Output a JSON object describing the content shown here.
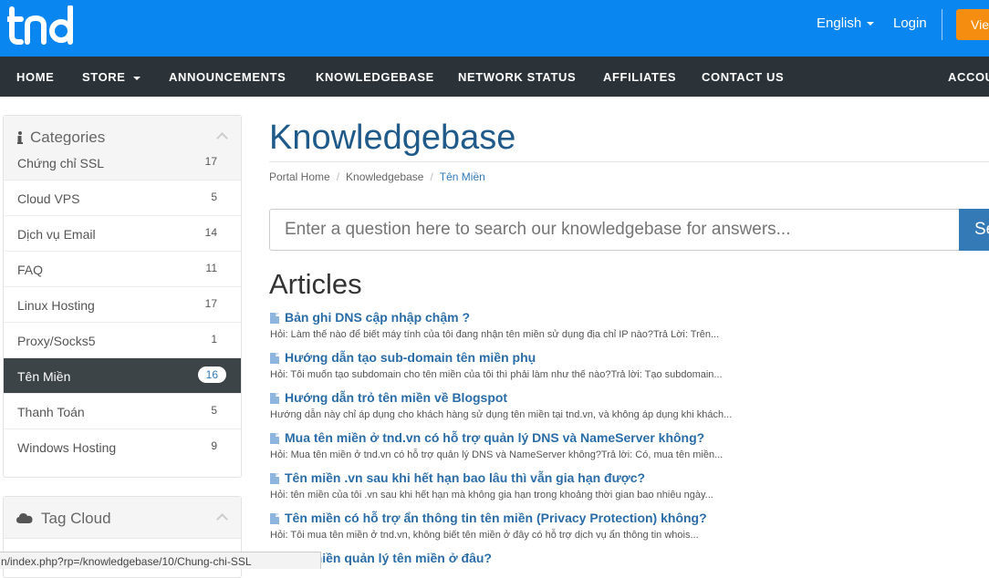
{
  "header": {
    "logo_text": "tnd",
    "language": "English",
    "login": "Login",
    "cta": "View"
  },
  "nav": {
    "items": [
      "HOME",
      "STORE",
      "ANNOUNCEMENTS",
      "KNOWLEDGEBASE",
      "NETWORK STATUS",
      "AFFILIATES",
      "CONTACT US",
      "ACCOUNT"
    ]
  },
  "sidebar": {
    "categories_title": "Categories",
    "categories": [
      {
        "name": "Chứng chỉ SSL",
        "count": "17"
      },
      {
        "name": "Cloud VPS",
        "count": "5"
      },
      {
        "name": "Dịch vụ Email",
        "count": "14"
      },
      {
        "name": "FAQ",
        "count": "11"
      },
      {
        "name": "Linux Hosting",
        "count": "17"
      },
      {
        "name": "Proxy/Socks5",
        "count": "1"
      },
      {
        "name": "Tên Miền",
        "count": "16"
      },
      {
        "name": "Thanh Toán",
        "count": "5"
      },
      {
        "name": "Windows Hosting",
        "count": "9"
      }
    ],
    "tag_cloud_title": "Tag Cloud"
  },
  "main": {
    "title": "Knowledgebase",
    "breadcrumb": [
      "Portal Home",
      "Knowledgebase",
      "Tên Miền"
    ],
    "search_placeholder": "Enter a question here to search our knowledgebase for answers...",
    "search_button": "Search",
    "articles_heading": "Articles",
    "articles": [
      {
        "title": "Bản ghi DNS cập nhập chậm ?",
        "excerpt": "Hỏi: Làm thế nào để biết máy tính của tôi đang nhận tên miền sử dụng địa chỉ IP nào?Trả Lời: Trên..."
      },
      {
        "title": "Hướng dẫn tạo sub-domain tên miền phụ",
        "excerpt": "Hỏi: Tôi muốn tạo subdomain cho tên miền của tôi thì phải làm như thế nào?Trả lời: Tạo subdomain..."
      },
      {
        "title": "Hướng dẫn trỏ tên miền về Blogspot",
        "excerpt": "Hướng dẫn này chỉ áp dụng cho khách hàng sử dụng tên miền tại tnd.vn, và không áp dụng khi khách..."
      },
      {
        "title": "Mua tên miền ở tnd.vn có hỗ trợ quản lý DNS và NameServer không?",
        "excerpt": "Hỏi: Mua tên miền ở tnd.vn có hỗ trợ quản lý DNS và NameServer không?Trả lời: Có, mua tên miền..."
      },
      {
        "title": "Tên miền .vn sau khi hết hạn bao lâu thì vẫn gia hạn được?",
        "excerpt": "Hỏi: tên miền của tôi .vn sau khi hết hạn mà không gia hạn trong khoảng thời gian bao nhiêu ngày..."
      },
      {
        "title": "Tên miền có hỗ trợ ẩn thông tin tên miền (Privacy Protection) không?",
        "excerpt": "Hỏi: Tôi mua tên miền ở tnd.vn, không biết tên miền ở đây có hỗ trợ dịch vụ ẩn thông tin whois..."
      },
      {
        "title": "Tên miền quản lý tên miền ở đâu?",
        "excerpt": ""
      }
    ]
  },
  "status_bar": {
    "url": "n/index.php?rp=/knowledgebase/10/Chung-chi-SSL"
  }
}
